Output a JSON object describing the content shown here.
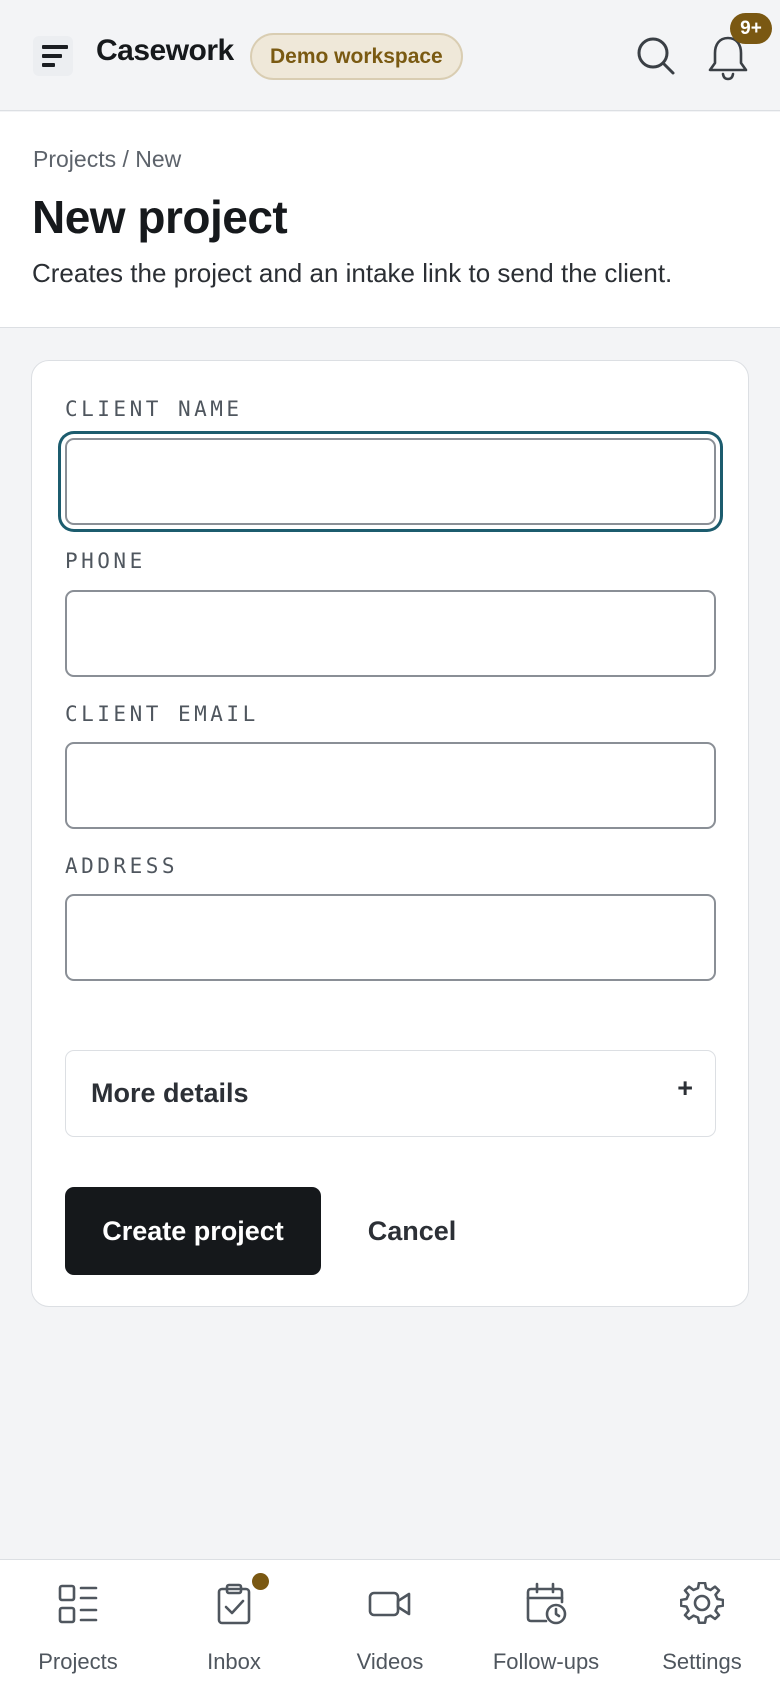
{
  "app": {
    "brand": "Casework",
    "workspace_badge": "Demo workspace",
    "notification_count": "9+"
  },
  "page": {
    "breadcrumb": [
      "Projects",
      "/",
      "New"
    ],
    "title": "New project",
    "subtitle": "Creates the project and an intake link to send the client."
  },
  "form": {
    "fields": [
      {
        "label": "CLIENT NAME",
        "value": "",
        "focused": true
      },
      {
        "label": "PHONE",
        "value": ""
      },
      {
        "label": "CLIENT EMAIL",
        "value": ""
      },
      {
        "label": "ADDRESS",
        "value": ""
      }
    ],
    "more_details": {
      "label": "More details",
      "toggle": "+"
    },
    "submit_label": "Create project",
    "cancel_label": "Cancel"
  },
  "bottom_nav": {
    "items": [
      {
        "label": "Projects",
        "icon": "projects-grid-icon"
      },
      {
        "label": "Inbox",
        "icon": "clipboard-check-icon",
        "has_dot": true
      },
      {
        "label": "Videos",
        "icon": "video-camera-icon"
      },
      {
        "label": "Follow-ups",
        "icon": "calendar-clock-icon"
      },
      {
        "label": "Settings",
        "icon": "gear-icon"
      }
    ]
  },
  "colors": {
    "accent_focus": "#1c5c6e",
    "badge_brown": "#7a5812",
    "primary_button": "#15181b",
    "workspace_badge_bg": "#efe8d9"
  }
}
